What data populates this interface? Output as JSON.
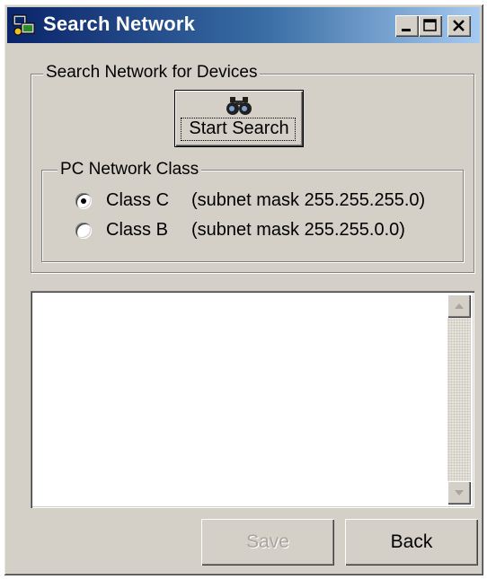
{
  "window": {
    "title": "Search Network"
  },
  "search_group": {
    "legend": "Search Network for Devices",
    "start_button_label": "Start Search"
  },
  "class_group": {
    "legend": "PC Network Class",
    "options": [
      {
        "label": "Class C",
        "description": "(subnet mask 255.255.255.0)",
        "selected": true
      },
      {
        "label": "Class B",
        "description": "(subnet mask 255.255.0.0)",
        "selected": false
      }
    ]
  },
  "results_list": {
    "items": []
  },
  "footer": {
    "save_label": "Save",
    "save_enabled": false,
    "back_label": "Back"
  },
  "colors": {
    "title_gradient_start": "#0a246a",
    "title_gradient_end": "#a6caf0",
    "face": "#d4d0c8",
    "disabled_text": "#a8a59e"
  }
}
